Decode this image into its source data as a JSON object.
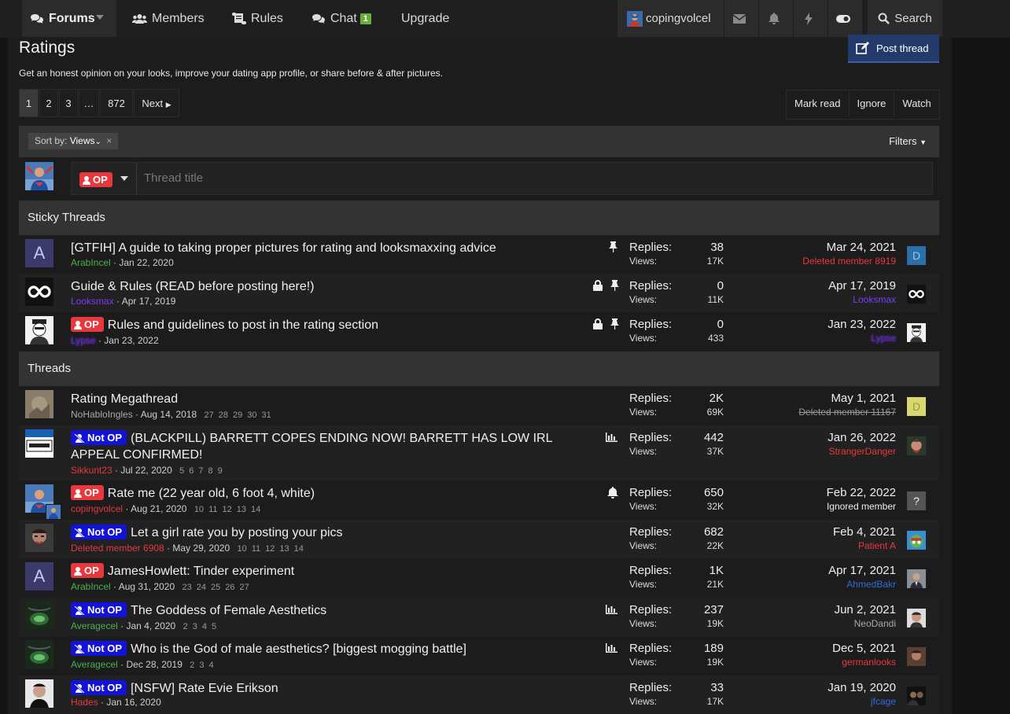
{
  "nav": {
    "forums": "Forums",
    "members": "Members",
    "rules": "Rules",
    "chat": "Chat",
    "chat_count": "1",
    "upgrade": "Upgrade",
    "username": "copingvolcel",
    "search": "Search"
  },
  "page": {
    "title": "Ratings",
    "description": "Get an honest opinion on your looks, improve your dating app profile, or share before & after pictures.",
    "post_thread": "Post thread"
  },
  "pagination": {
    "p1": "1",
    "p2": "2",
    "p3": "3",
    "ellipsis": "…",
    "last": "872",
    "next": "Next"
  },
  "tools": {
    "mark_read": "Mark read",
    "ignore": "Ignore",
    "watch": "Watch"
  },
  "filter": {
    "sort_label": "Sort by:",
    "sort_value": "Views",
    "filters": "Filters"
  },
  "quick": {
    "prefix": "OP",
    "placeholder": "Thread title"
  },
  "sections": {
    "sticky": "Sticky Threads",
    "threads": "Threads"
  },
  "labels": {
    "replies": "Replies:",
    "views": "Views:",
    "op": "OP",
    "not_op": "Not OP"
  },
  "colors": {
    "op": "#e8383d",
    "not_op": "#1212d8",
    "green_user": "#4caf50",
    "red_user": "#e8383d",
    "purple_user": "#7a3cff",
    "blue_user": "#2f6bd8"
  },
  "sticky": [
    {
      "title": "[GTFIH] A guide to taking proper pictures for rating and looksmaxxing advice",
      "author": "ArabIncel",
      "date": "Jan 22, 2020",
      "replies": "38",
      "views": "17K",
      "last_date": "Mar 24, 2021",
      "last_user": "Deleted member 8919",
      "avatar_letter": "A",
      "last_letter": "D"
    },
    {
      "title": "Guide & Rules (READ before posting here!)",
      "author": "Looksmax",
      "date": "Apr 17, 2019",
      "replies": "0",
      "views": "11K",
      "last_date": "Apr 17, 2019",
      "last_user": "Looksmax"
    },
    {
      "prefix": "OP",
      "title": "Rules and guidelines to post in the rating section",
      "author": "Lypse",
      "date": "Jan 23, 2022",
      "replies": "0",
      "views": "433",
      "last_date": "Jan 23, 2022",
      "last_user": "Lypse"
    }
  ],
  "threads": [
    {
      "title": "Rating Megathread",
      "author": "NoHabloIngles",
      "date": "Aug 14, 2018",
      "pages": [
        "27",
        "28",
        "29",
        "30",
        "31"
      ],
      "replies": "2K",
      "views": "69K",
      "last_date": "May 1, 2021",
      "last_user": "Deleted member 11167",
      "last_letter": "D"
    },
    {
      "prefix": "Not OP",
      "title": "(BLACKPILL) BARRETT COPES ENDING NOW! BARRETT HAS LOW IRL APPEAL CONFIRMED!",
      "author": "Sikkunt23",
      "date": "Jul 22, 2020",
      "pages": [
        "5",
        "6",
        "7",
        "8",
        "9"
      ],
      "replies": "442",
      "views": "37K",
      "last_date": "Jan 26, 2022",
      "last_user": "StrangerDanger"
    },
    {
      "prefix": "OP",
      "title": "Rate me (22 year old, 6 foot 4, white)",
      "author": "copingvolcel",
      "date": "Aug 21, 2020",
      "pages": [
        "10",
        "11",
        "12",
        "13",
        "14"
      ],
      "replies": "650",
      "views": "32K",
      "last_date": "Feb 22, 2022",
      "last_user": "Ignored member",
      "last_letter": "?"
    },
    {
      "prefix": "Not OP",
      "title": "Let a girl rate you by posting your pics",
      "author": "Deleted member 6908",
      "date": "May 29, 2020",
      "pages": [
        "10",
        "11",
        "12",
        "13",
        "14"
      ],
      "replies": "682",
      "views": "22K",
      "last_date": "Feb 4, 2021",
      "last_user": "Patient A"
    },
    {
      "prefix": "OP",
      "title": "JamesHowlett: Tinder experiment",
      "author": "ArabIncel",
      "date": "Aug 31, 2020",
      "pages": [
        "23",
        "24",
        "25",
        "26",
        "27"
      ],
      "replies": "1K",
      "views": "21K",
      "last_date": "Apr 17, 2021",
      "last_user": "AhmedBakr",
      "avatar_letter": "A"
    },
    {
      "prefix": "Not OP",
      "title": "The Goddess of Female Aesthetics",
      "author": "Averagecel",
      "date": "Jan 4, 2020",
      "pages": [
        "2",
        "3",
        "4",
        "5"
      ],
      "replies": "237",
      "views": "19K",
      "last_date": "Jun 2, 2021",
      "last_user": "NeoDandi"
    },
    {
      "prefix": "Not OP",
      "title": "Who is the God of male aesthetics? [biggest mogging battle]",
      "author": "Averagecel",
      "date": "Dec 28, 2019",
      "pages": [
        "2",
        "3",
        "4"
      ],
      "replies": "189",
      "views": "19K",
      "last_date": "Dec 5, 2021",
      "last_user": "germanlooks"
    },
    {
      "prefix": "Not OP",
      "title": "[NSFW] Rate Evie Erikson",
      "author": "Hades",
      "date": "Jan 16, 2020",
      "pages": [],
      "replies": "33",
      "views": "17K",
      "last_date": "Jan 19, 2020",
      "last_user": "jfcage"
    }
  ]
}
